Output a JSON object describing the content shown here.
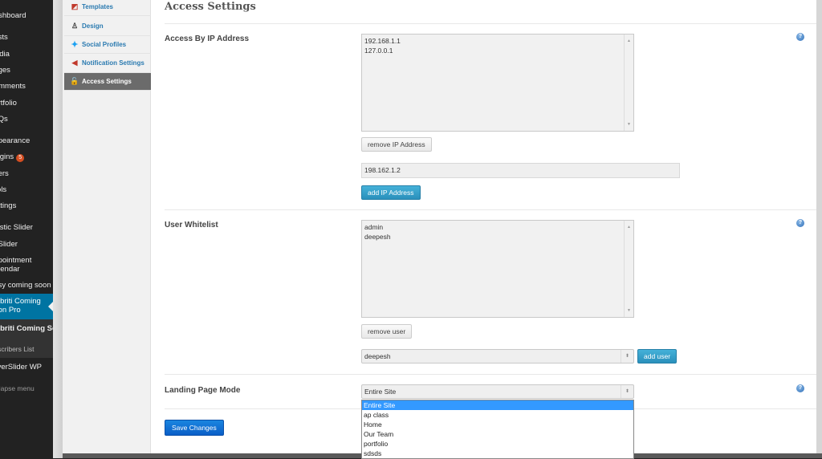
{
  "admin_menu": {
    "items": [
      {
        "label": "Dashboard"
      },
      {
        "label": "Posts"
      },
      {
        "label": "Media"
      },
      {
        "label": "Pages"
      },
      {
        "label": "Comments"
      },
      {
        "label": "Portfolio"
      },
      {
        "label": "FAQs"
      },
      {
        "label": "Appearance"
      },
      {
        "label": "Plugins",
        "badge": "5"
      },
      {
        "label": "Users"
      },
      {
        "label": "Tools"
      },
      {
        "label": "Settings"
      },
      {
        "label": "Elastic Slider"
      },
      {
        "label": "CzSlider"
      },
      {
        "label": "Appointment Calendar"
      },
      {
        "label": "Easy coming soon"
      },
      {
        "label": "Webriti Coming Soon Pro"
      },
      {
        "label": "Webriti Coming Soon"
      },
      {
        "label": "Subscribers List"
      },
      {
        "label": "LayerSlider WP"
      },
      {
        "label": "Collapse menu"
      }
    ]
  },
  "tabs": [
    {
      "label": "Templates",
      "icon": "templates-icon"
    },
    {
      "label": "Design",
      "icon": "design-icon"
    },
    {
      "label": "Social Profiles",
      "icon": "twitter-icon"
    },
    {
      "label": "Notification Settings",
      "icon": "megaphone-icon"
    },
    {
      "label": "Access Settings",
      "icon": "lock-icon",
      "active": true
    }
  ],
  "page": {
    "title": "Access Settings",
    "ip_section": {
      "label": "Access By IP Address",
      "ip_list": [
        "192.168.1.1",
        "127.0.0.1"
      ],
      "remove_button": "remove IP Address",
      "ip_input_value": "198.162.1.2",
      "add_button": "add IP Address"
    },
    "user_section": {
      "label": "User Whitelist",
      "user_list": [
        "admin",
        "deepesh"
      ],
      "remove_button": "remove user",
      "user_select_value": "deepesh",
      "add_button": "add user"
    },
    "landing_section": {
      "label": "Landing Page Mode",
      "selected": "Entire Site",
      "options": [
        "Entire Site",
        "ap class",
        "Home",
        "Our Team",
        "portfolio",
        "sdsds"
      ]
    },
    "save_button": "Save Changes",
    "help_symbol": "?"
  }
}
